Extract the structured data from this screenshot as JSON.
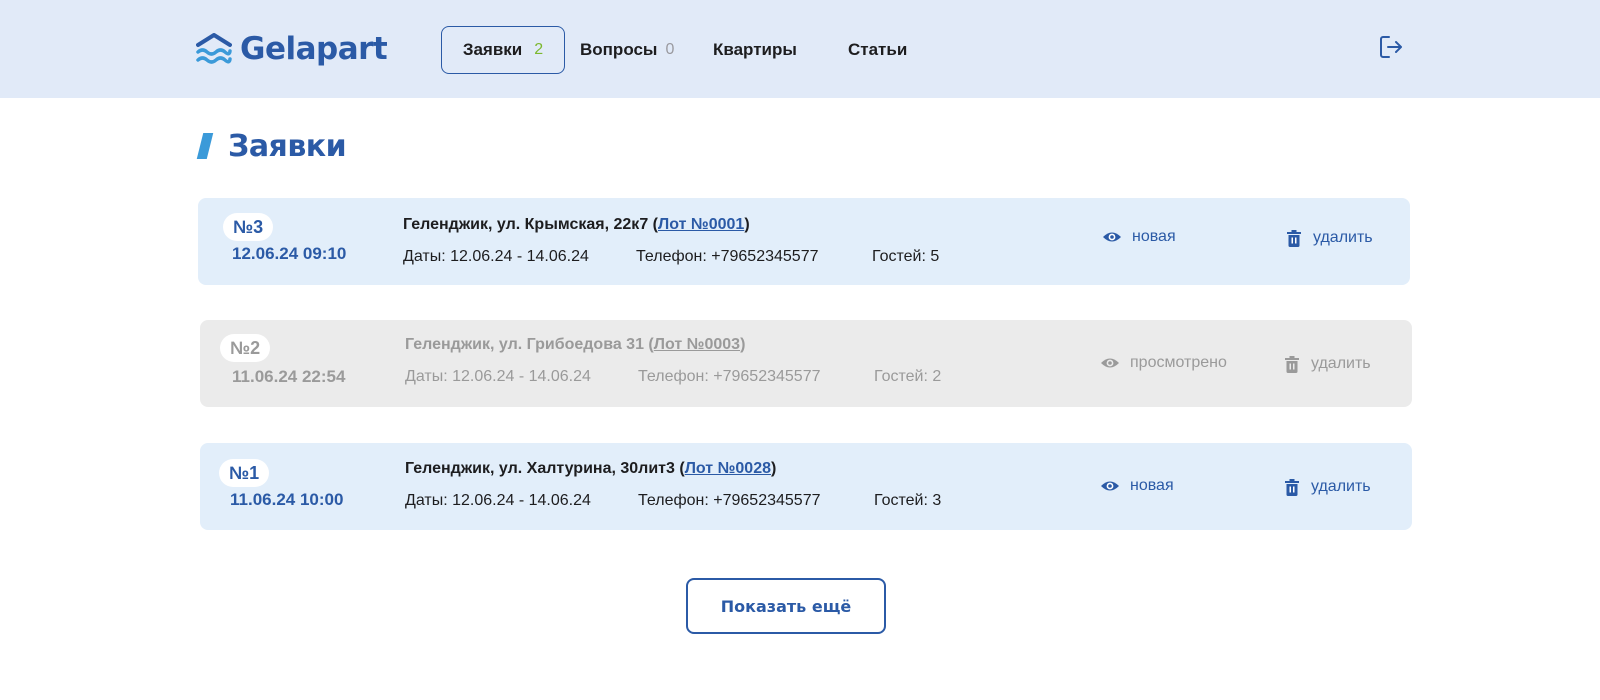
{
  "header": {
    "logo_text": "Gelapart",
    "nav": [
      {
        "label": "Заявки",
        "count": "2"
      },
      {
        "label": "Вопросы",
        "count": "0"
      },
      {
        "label": "Квартиры"
      },
      {
        "label": "Статьи"
      }
    ]
  },
  "page": {
    "title": "Заявки"
  },
  "requests": [
    {
      "number": "№3",
      "datetime": "12.06.24 09:10",
      "address": "Геленджик, ул. Крымская, 22к7",
      "lot": "Лот №0001",
      "dates": "Даты: 12.06.24 - 14.06.24",
      "phone": "Телефон: +79652345577",
      "guests": "Гостей: 5",
      "status": "новая",
      "delete_label": "удалить"
    },
    {
      "number": "№2",
      "datetime": "11.06.24 22:54",
      "address": "Геленджик, ул. Грибоедова 31",
      "lot": "Лот №0003",
      "dates": "Даты: 12.06.24 - 14.06.24",
      "phone": "Телефон: +79652345577",
      "guests": "Гостей: 2",
      "status": "просмотрено",
      "delete_label": "удалить"
    },
    {
      "number": "№1",
      "datetime": "11.06.24 10:00",
      "address": "Геленджик, ул. Халтурина, 30лит3",
      "lot": "Лот №0028",
      "dates": "Даты: 12.06.24 - 14.06.24",
      "phone": "Телефон: +79652345577",
      "guests": "Гостей: 3",
      "status": "новая",
      "delete_label": "удалить"
    }
  ],
  "show_more_label": "Показать ещё",
  "colors": {
    "brand": "#2b5aa6",
    "header_bg": "#e1eaf8",
    "card_new_bg": "#e2eefa",
    "card_seen_bg": "#ebebeb",
    "accent_green": "#7cb82f",
    "accent_light_blue": "#3b9ad9"
  },
  "icons": {
    "logo": "waves-roof-icon",
    "logout": "logout-icon",
    "status": "eye-icon",
    "delete": "trash-icon"
  }
}
